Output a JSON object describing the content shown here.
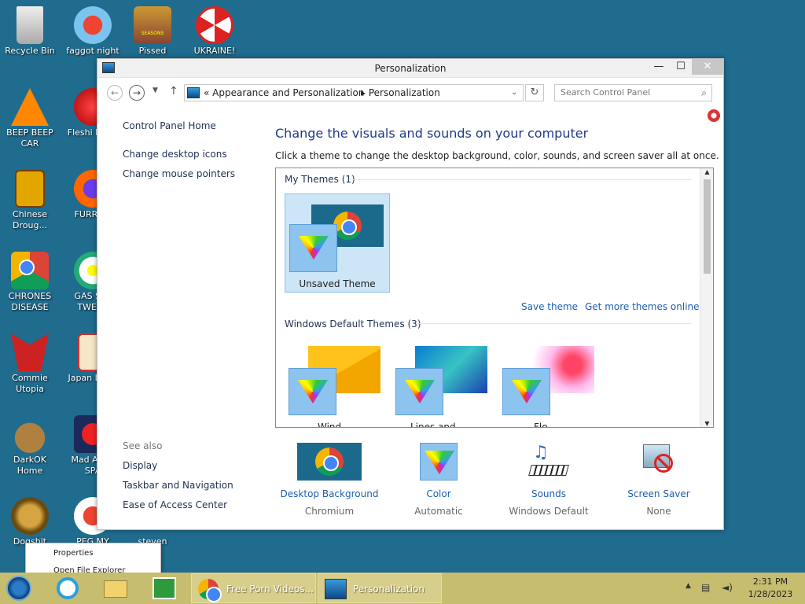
{
  "desktop": {
    "icons": [
      {
        "label": "Recycle Bin"
      },
      {
        "label": "faggot night"
      },
      {
        "label": "Pissed"
      },
      {
        "label": "UKRAINE!"
      },
      {
        "label": "BEEP BEEP CAR"
      },
      {
        "label": "Fleshi DELU"
      },
      {
        "label": "Chinese Droug..."
      },
      {
        "label": "FURRY C"
      },
      {
        "label": "CHRONES DISEASE"
      },
      {
        "label": "GAS STA TWEAK"
      },
      {
        "label": "Commie Utopia"
      },
      {
        "label": "Japan Loli P"
      },
      {
        "label": "DarkOK Home"
      },
      {
        "label": "Mad Av IN SPA"
      },
      {
        "label": "Dogshit"
      },
      {
        "label": "PEG MY WIFE!"
      },
      {
        "label": "steven"
      }
    ],
    "thumb_text": "SEASONS"
  },
  "window": {
    "title": "Personalization",
    "controls": {
      "min": "—",
      "max": "☐",
      "close": "✕"
    },
    "address": {
      "prefix": "«",
      "crumb1": "Appearance and Personalization",
      "crumb2": "Personalization",
      "search_placeholder": "Search Control Panel"
    },
    "left_nav": {
      "home": "Control Panel Home",
      "links": [
        "Change desktop icons",
        "Change mouse pointers"
      ],
      "see_also_title": "See also",
      "see_also": [
        "Display",
        "Taskbar and Navigation",
        "Ease of Access Center"
      ]
    },
    "heading": "Change the visuals and sounds on your computer",
    "subtext": "Click a theme to change the desktop background, color, sounds, and screen saver all at once.",
    "my_themes_title": "My Themes (1)",
    "unsaved_theme": "Unsaved Theme",
    "save_theme": "Save theme",
    "get_more": "Get more themes online",
    "default_themes_title": "Windows Default Themes (3)",
    "default_themes": [
      "Wind",
      "Lines and",
      "Flo"
    ],
    "bottom": [
      {
        "label": "Desktop Background",
        "value": "Chromium"
      },
      {
        "label": "Color",
        "value": "Automatic"
      },
      {
        "label": "Sounds",
        "value": "Windows Default"
      },
      {
        "label": "Screen Saver",
        "value": "None"
      }
    ]
  },
  "context_menu": {
    "items": [
      "Properties",
      "Open File Explorer"
    ]
  },
  "taskbar": {
    "tasks": [
      "Free Porn Videos...",
      "Personalization"
    ],
    "time": "2:31 PM",
    "date": "1/28/2023"
  },
  "colors": {
    "desktop": "#1f6c8e",
    "taskbar": "#c6bd6f",
    "link": "#1a5fb4",
    "heading": "#1e3a8a"
  }
}
